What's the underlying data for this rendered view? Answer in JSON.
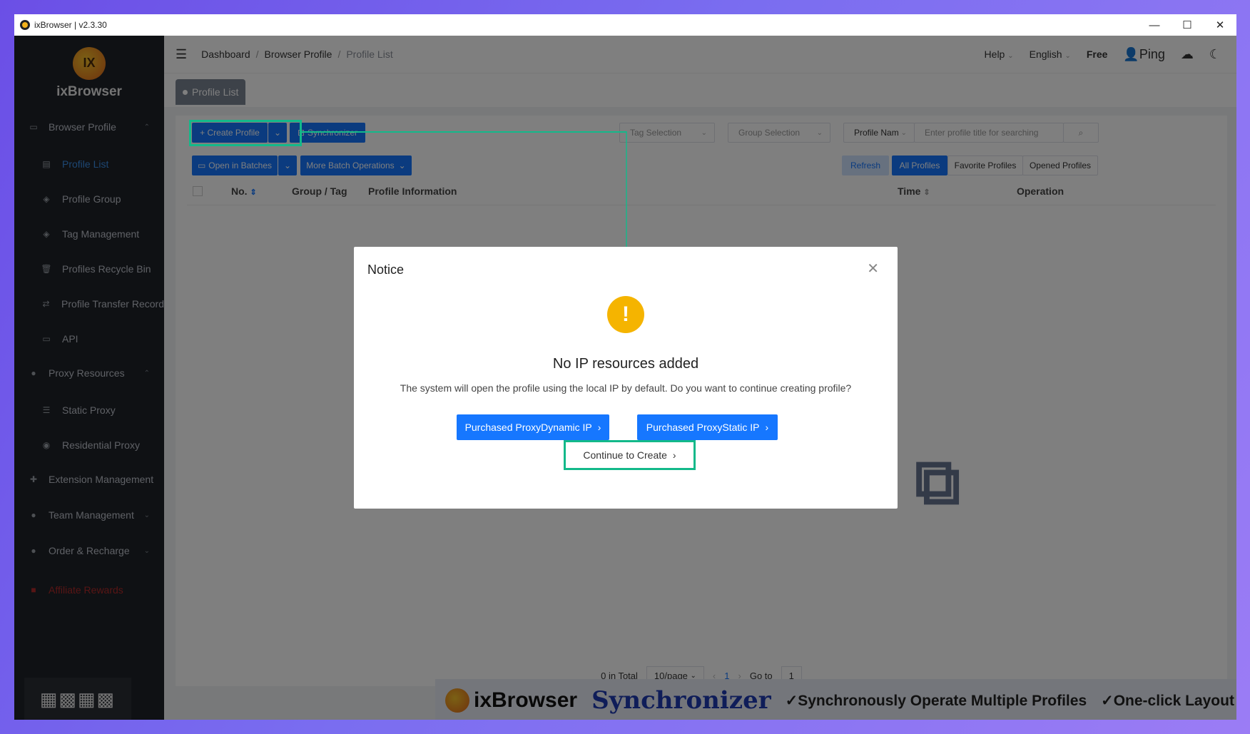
{
  "window": {
    "title": "ixBrowser | v2.3.30",
    "controls": {
      "minimize": "—",
      "maximize": "☐",
      "close": "✕"
    }
  },
  "sidebar": {
    "brand": "ixBrowser",
    "logo_text": "IX",
    "items": [
      {
        "label": "Browser Profile",
        "icon": "browser-icon"
      },
      {
        "label": "Profile List",
        "icon": "list-icon"
      },
      {
        "label": "Profile Group",
        "icon": "layers-icon"
      },
      {
        "label": "Tag Management",
        "icon": "tag-icon"
      },
      {
        "label": "Profiles Recycle Bin",
        "icon": "trash-icon"
      },
      {
        "label": "Profile Transfer Record",
        "icon": "transfer-icon"
      },
      {
        "label": "API",
        "icon": "api-icon"
      },
      {
        "label": "Proxy Resources",
        "icon": "globe-icon"
      },
      {
        "label": "Static Proxy",
        "icon": "list-icon"
      },
      {
        "label": "Residential Proxy",
        "icon": "residential-icon"
      },
      {
        "label": "Extension Management",
        "icon": "puzzle-icon"
      },
      {
        "label": "Team Management",
        "icon": "team-icon"
      },
      {
        "label": "Order & Recharge",
        "icon": "order-icon"
      },
      {
        "label": "Affiliate Rewards",
        "icon": "gift-icon"
      }
    ]
  },
  "topbar": {
    "breadcrumb": [
      "Dashboard",
      "Browser Profile",
      "Profile List"
    ],
    "help": "Help",
    "language": "English",
    "plan": "Free",
    "user": "Ping"
  },
  "tabs": {
    "active": "Profile List"
  },
  "toolbar": {
    "create_profile": "+ Create Profile",
    "synchronizer": "Synchronizer",
    "tag_selection": "Tag Selection",
    "group_selection": "Group Selection",
    "search_field_type": "Profile Nam",
    "search_placeholder": "Enter profile title for searching",
    "open_in_batches": "Open in Batches",
    "more_batch": "More Batch Operations",
    "refresh": "Refresh",
    "filter_tabs": [
      "All Profiles",
      "Favorite Profiles",
      "Opened Profiles"
    ]
  },
  "table": {
    "columns": [
      "No.",
      "Group / Tag",
      "Profile Information",
      "Time",
      "Operation"
    ]
  },
  "pagination": {
    "total": "0 in Total",
    "page_size": "10/page",
    "current_page": "1",
    "goto_label": "Go to",
    "goto_value": "1"
  },
  "banner": {
    "brand": "ixBrowser",
    "product": "Synchronizer",
    "feature1": "✓Synchronously Operate Multiple Profiles",
    "feature2": "✓One-click Layout"
  },
  "modal": {
    "title": "Notice",
    "icon": "!",
    "heading": "No IP resources added",
    "description": "The system will open the profile using the local IP by default. Do you want to continue creating profile?",
    "button_dynamic": "Purchased ProxyDynamic IP",
    "button_static": "Purchased ProxyStatic IP",
    "continue": "Continue to Create"
  },
  "colors": {
    "accent": "#1677ff",
    "highlight": "#13b98a",
    "warning": "#f5b400",
    "sidebar_bg": "#1f2329"
  }
}
